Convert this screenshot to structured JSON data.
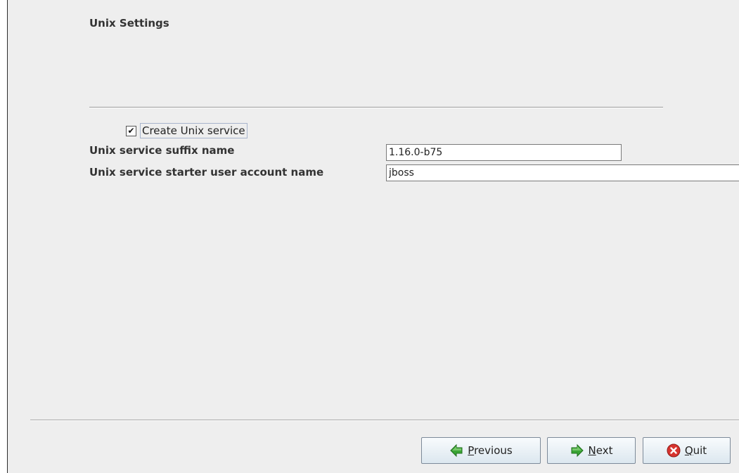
{
  "panel": {
    "title": "Unix Settings"
  },
  "checkbox": {
    "label": "Create Unix service",
    "checked": true,
    "check_glyph": "✔"
  },
  "fields": {
    "suffix": {
      "label": "Unix service suffix name",
      "value": "1.16.0-b75"
    },
    "starter": {
      "label": "Unix service starter user account name",
      "value": "jboss"
    }
  },
  "buttons": {
    "previous": {
      "mnemonic": "P",
      "rest": "revious",
      "icon": "arrow-left-icon",
      "icon_color": "#3aa535"
    },
    "next": {
      "mnemonic": "N",
      "rest": "ext",
      "icon": "arrow-right-icon",
      "icon_color": "#3aa535"
    },
    "quit": {
      "mnemonic": "Q",
      "rest": "uit",
      "icon": "close-circle-icon",
      "icon_color": "#d7342f"
    }
  }
}
